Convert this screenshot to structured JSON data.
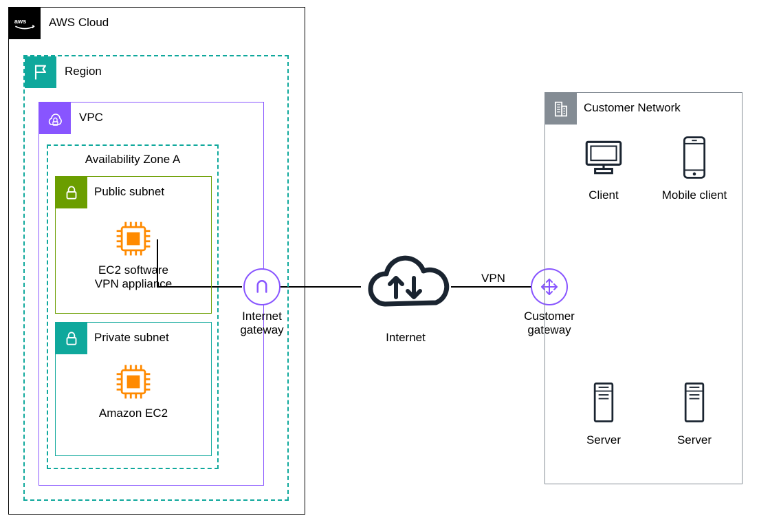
{
  "aws_cloud": {
    "label": "AWS Cloud"
  },
  "region": {
    "label": "Region"
  },
  "vpc": {
    "label": "VPC"
  },
  "availability_zone": {
    "label": "Availability Zone A"
  },
  "public_subnet": {
    "label": "Public subnet",
    "ec2_label": "EC2 software\nVPN appliance"
  },
  "private_subnet": {
    "label": "Private subnet",
    "ec2_label": "Amazon EC2"
  },
  "internet_gateway": {
    "label": "Internet\ngateway"
  },
  "internet": {
    "label": "Internet"
  },
  "vpn_link": {
    "label": "VPN"
  },
  "customer_gateway": {
    "label": "Customer\ngateway"
  },
  "customer_network": {
    "label": "Customer Network",
    "client": "Client",
    "mobile_client": "Mobile client",
    "server1": "Server",
    "server2": "Server"
  }
}
